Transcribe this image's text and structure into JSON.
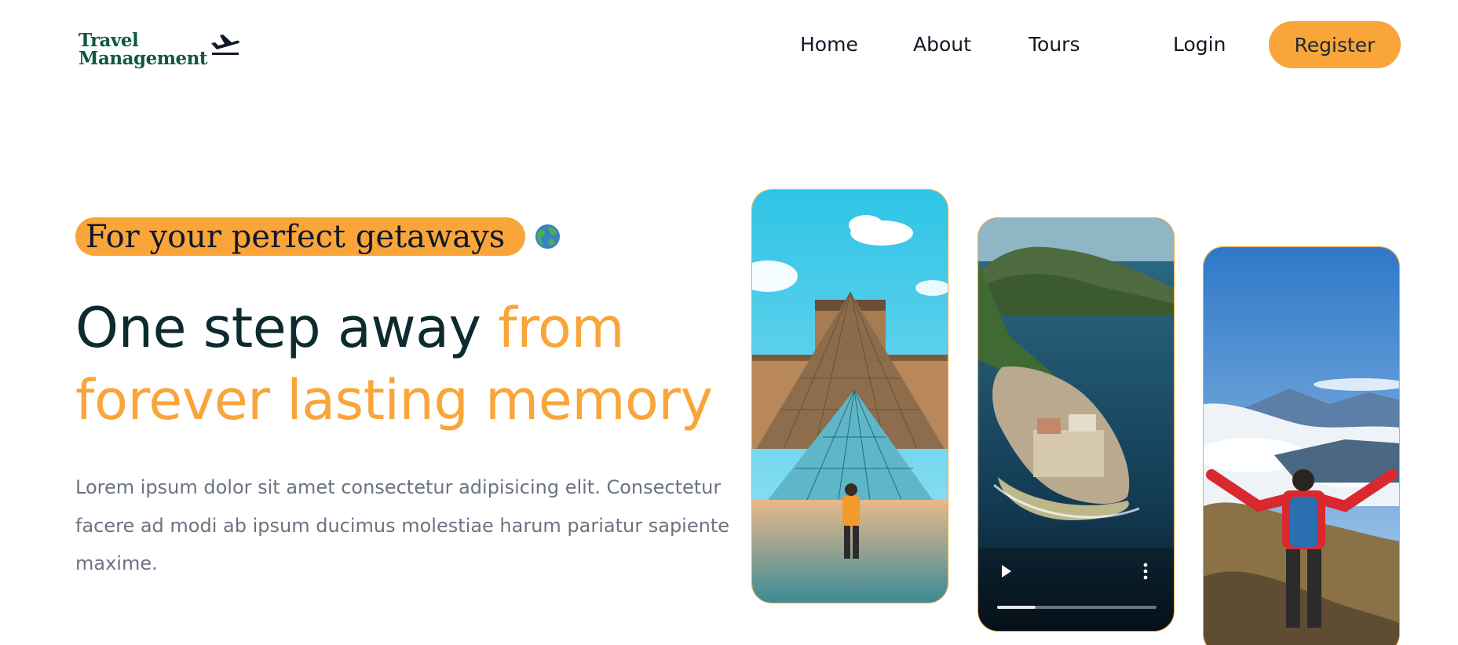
{
  "header": {
    "logo_line1": "Travel",
    "logo_line2": "Management",
    "logo_icon": "airplane-takeoff-icon",
    "nav": [
      "Home",
      "About",
      "Tours"
    ],
    "login_label": "Login",
    "register_label": "Register"
  },
  "hero": {
    "badge": "For your perfect getaways",
    "badge_icon": "globe-icon",
    "headline_plain": "One step away ",
    "headline_highlight_1": "from",
    "headline_highlight_2": "forever lasting memory",
    "description": "Lorem ipsum dolor sit amet consectetur adipisicing elit. Consectetur facere ad modi ab ipsum ducimus molestiae harum pariatur sapiente maxime."
  },
  "gallery": {
    "video_progress": 0.24,
    "video_icons": [
      "play-icon",
      "more-vertical-icon"
    ]
  },
  "colors": {
    "accent": "#f9a53a",
    "heading": "#0d2a2e",
    "logo": "#0f5a3a",
    "body_text": "#6b7280"
  }
}
